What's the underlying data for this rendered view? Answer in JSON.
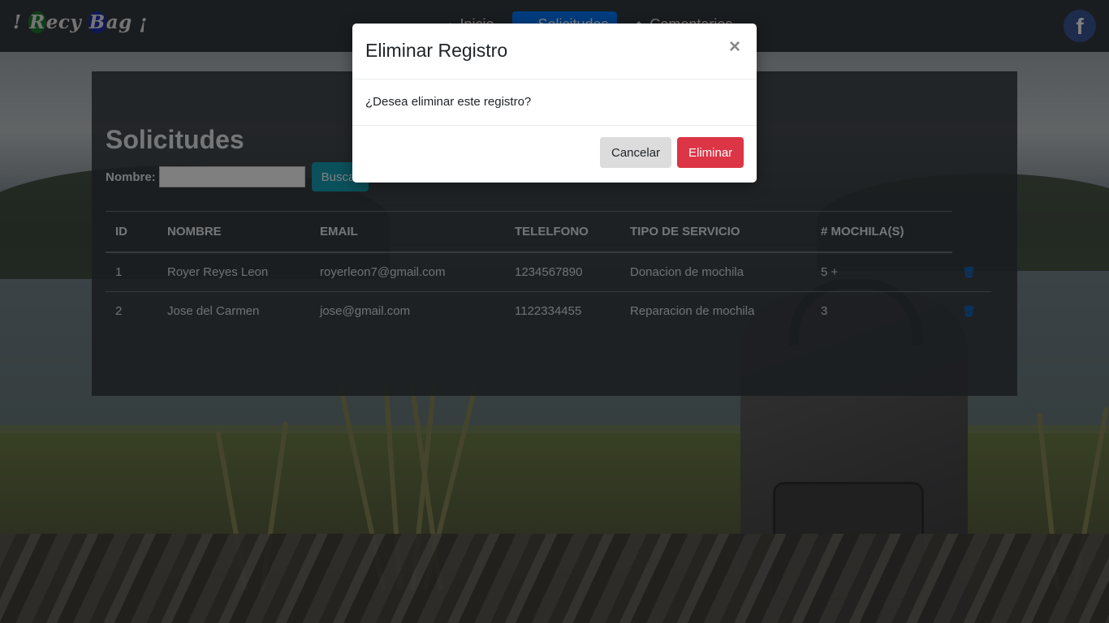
{
  "brand": {
    "prefix": "!",
    "text_r": "R",
    "text_ec": "ecy",
    "text_b": "B",
    "text_ag": "ag",
    "suffix": "¡"
  },
  "nav": {
    "items": [
      {
        "label": "Inicio",
        "icon": "home-icon"
      },
      {
        "label": "Solicitudes",
        "icon": "folder-icon",
        "active": true
      },
      {
        "label": "Comentarios",
        "icon": "comment-icon"
      }
    ]
  },
  "social": {
    "facebook_glyph": "f",
    "color": "#3b5998"
  },
  "main": {
    "title": "Solicitudes",
    "search": {
      "label": "Nombre:",
      "value": "",
      "button_label": "Buscar"
    },
    "table": {
      "headers": [
        "ID",
        "NOMBRE",
        "EMAIL",
        "TELELFONO",
        "TIPO DE SERVICIO",
        "# MOCHILA(S)"
      ],
      "rows": [
        {
          "id": "1",
          "nombre": "Royer Reyes Leon",
          "email": "royerleon7@gmail.com",
          "telefono": "1234567890",
          "servicio": "Donacion de mochila",
          "mochilas": "5 +"
        },
        {
          "id": "2",
          "nombre": "Jose del Carmen",
          "email": "jose@gmail.com",
          "telefono": "1122334455",
          "servicio": "Reparacion de mochila",
          "mochilas": "3"
        }
      ]
    }
  },
  "modal": {
    "title": "Eliminar Registro",
    "close_label": "×",
    "message": "¿Desea eliminar este registro?",
    "cancel_label": "Cancelar",
    "delete_label": "Eliminar"
  },
  "colors": {
    "primary": "#007bff",
    "danger": "#dc3545",
    "info": "#17a2b8",
    "navbar": "#343a40"
  }
}
